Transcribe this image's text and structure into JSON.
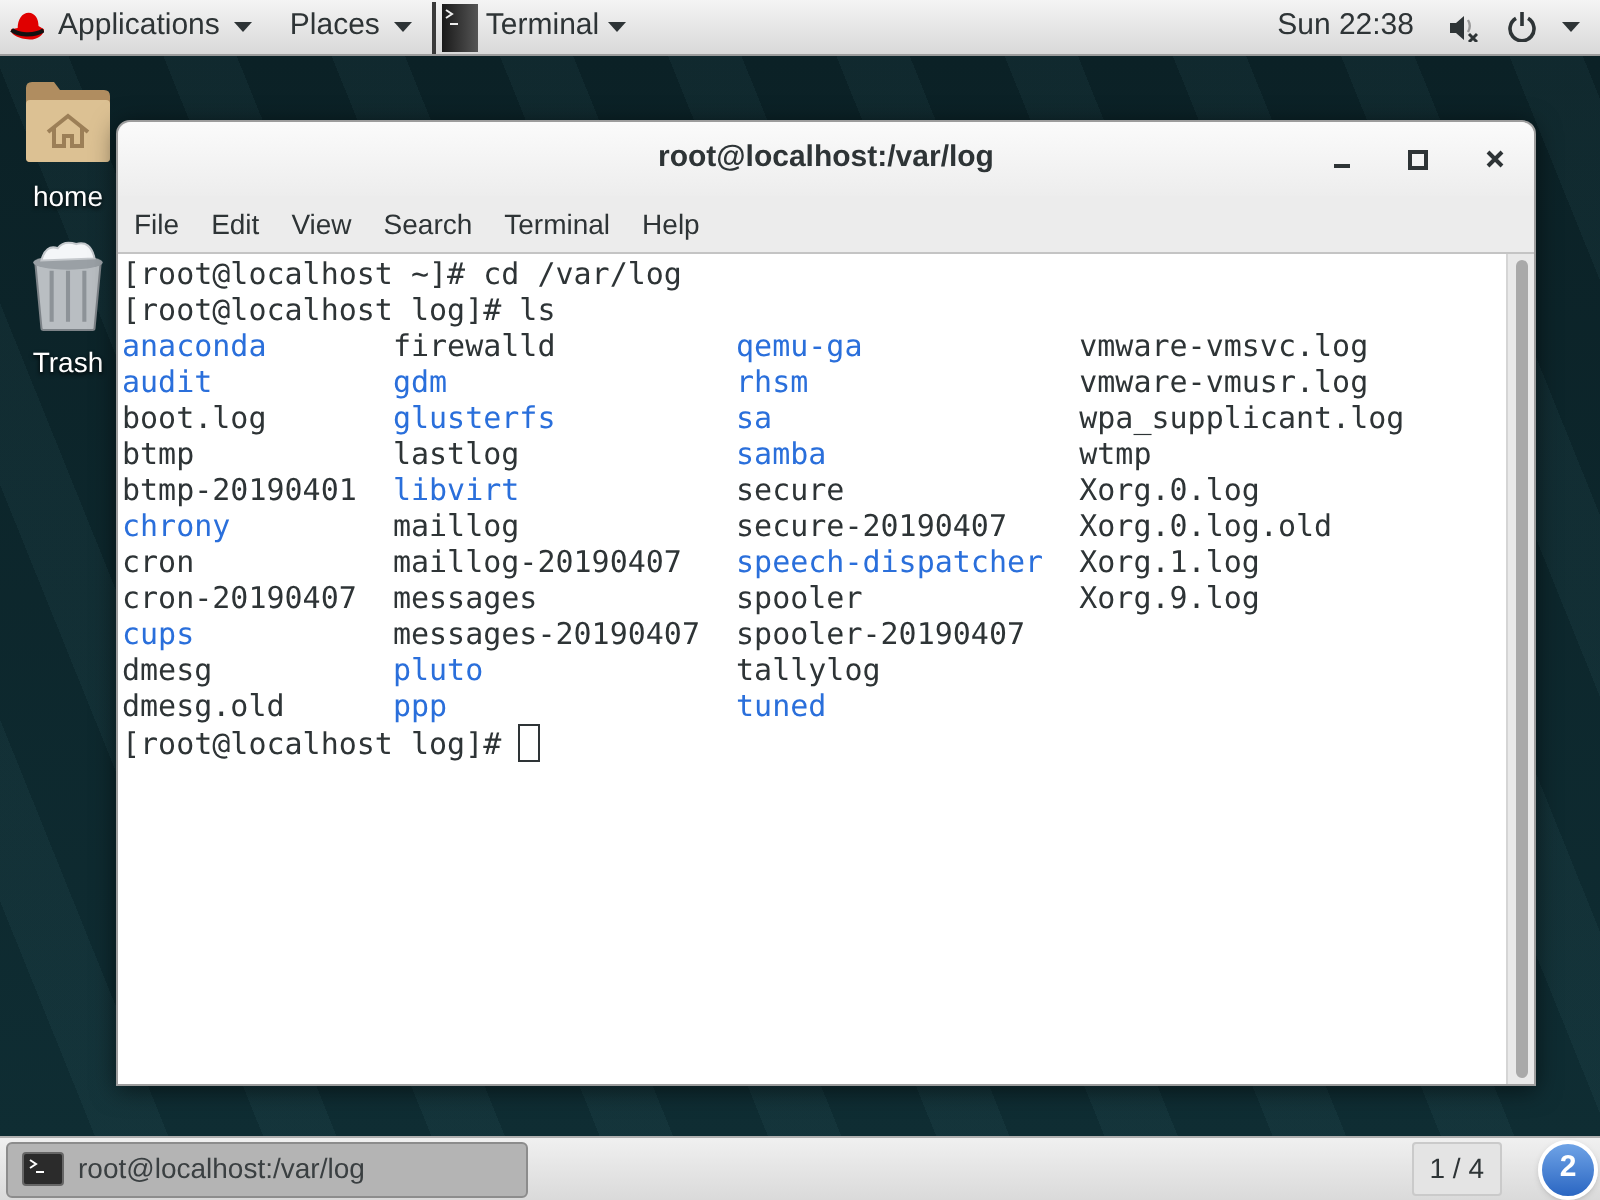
{
  "top_bar": {
    "menus": [
      {
        "label": "Applications",
        "kind": "applications"
      },
      {
        "label": "Places",
        "kind": "places"
      },
      {
        "label": "Terminal",
        "kind": "app"
      }
    ],
    "clock": "Sun 22:38"
  },
  "desktop": {
    "shortcuts": [
      {
        "label": "home",
        "kind": "home"
      },
      {
        "label": "Trash",
        "kind": "trash"
      }
    ]
  },
  "window": {
    "title": "root@localhost:/var/log",
    "menu": [
      "File",
      "Edit",
      "View",
      "Search",
      "Terminal",
      "Help"
    ],
    "terminal": [
      {
        "kind": "command",
        "text": "[root@localhost ~]# cd /var/log"
      },
      {
        "kind": "command",
        "text": "[root@localhost log]# ls"
      },
      {
        "kind": "listing",
        "columns": [
          [
            {
              "name": "anaconda",
              "kind": "directory"
            },
            {
              "name": "audit",
              "kind": "directory"
            },
            {
              "name": "boot.log",
              "kind": "file"
            },
            {
              "name": "btmp",
              "kind": "file"
            },
            {
              "name": "btmp-20190401",
              "kind": "file"
            },
            {
              "name": "chrony",
              "kind": "directory"
            },
            {
              "name": "cron",
              "kind": "file"
            },
            {
              "name": "cron-20190407",
              "kind": "file"
            },
            {
              "name": "cups",
              "kind": "directory"
            },
            {
              "name": "dmesg",
              "kind": "file"
            },
            {
              "name": "dmesg.old",
              "kind": "file"
            }
          ],
          [
            {
              "name": "firewalld",
              "kind": "file"
            },
            {
              "name": "gdm",
              "kind": "directory"
            },
            {
              "name": "glusterfs",
              "kind": "directory"
            },
            {
              "name": "lastlog",
              "kind": "file"
            },
            {
              "name": "libvirt",
              "kind": "directory"
            },
            {
              "name": "maillog",
              "kind": "file"
            },
            {
              "name": "maillog-20190407",
              "kind": "file"
            },
            {
              "name": "messages",
              "kind": "file"
            },
            {
              "name": "messages-20190407",
              "kind": "file"
            },
            {
              "name": "pluto",
              "kind": "directory"
            },
            {
              "name": "ppp",
              "kind": "directory"
            }
          ],
          [
            {
              "name": "qemu-ga",
              "kind": "directory"
            },
            {
              "name": "rhsm",
              "kind": "directory"
            },
            {
              "name": "sa",
              "kind": "directory"
            },
            {
              "name": "samba",
              "kind": "directory"
            },
            {
              "name": "secure",
              "kind": "file"
            },
            {
              "name": "secure-20190407",
              "kind": "file"
            },
            {
              "name": "speech-dispatcher",
              "kind": "directory"
            },
            {
              "name": "spooler",
              "kind": "file"
            },
            {
              "name": "spooler-20190407",
              "kind": "file"
            },
            {
              "name": "tallylog",
              "kind": "file"
            },
            {
              "name": "tuned",
              "kind": "directory"
            }
          ],
          [
            {
              "name": "vmware-vmsvc.log",
              "kind": "file"
            },
            {
              "name": "vmware-vmusr.log",
              "kind": "file"
            },
            {
              "name": "wpa_supplicant.log",
              "kind": "file"
            },
            {
              "name": "wtmp",
              "kind": "file"
            },
            {
              "name": "Xorg.0.log",
              "kind": "file"
            },
            {
              "name": "Xorg.0.log.old",
              "kind": "file"
            },
            {
              "name": "Xorg.1.log",
              "kind": "file"
            },
            {
              "name": "Xorg.9.log",
              "kind": "file"
            }
          ]
        ]
      },
      {
        "kind": "prompt",
        "text": "[root@localhost log]#"
      }
    ]
  },
  "taskbar": {
    "task": {
      "label": "root@localhost:/var/log",
      "selected": true
    },
    "workspace": "1 / 4",
    "notifications": "2"
  }
}
